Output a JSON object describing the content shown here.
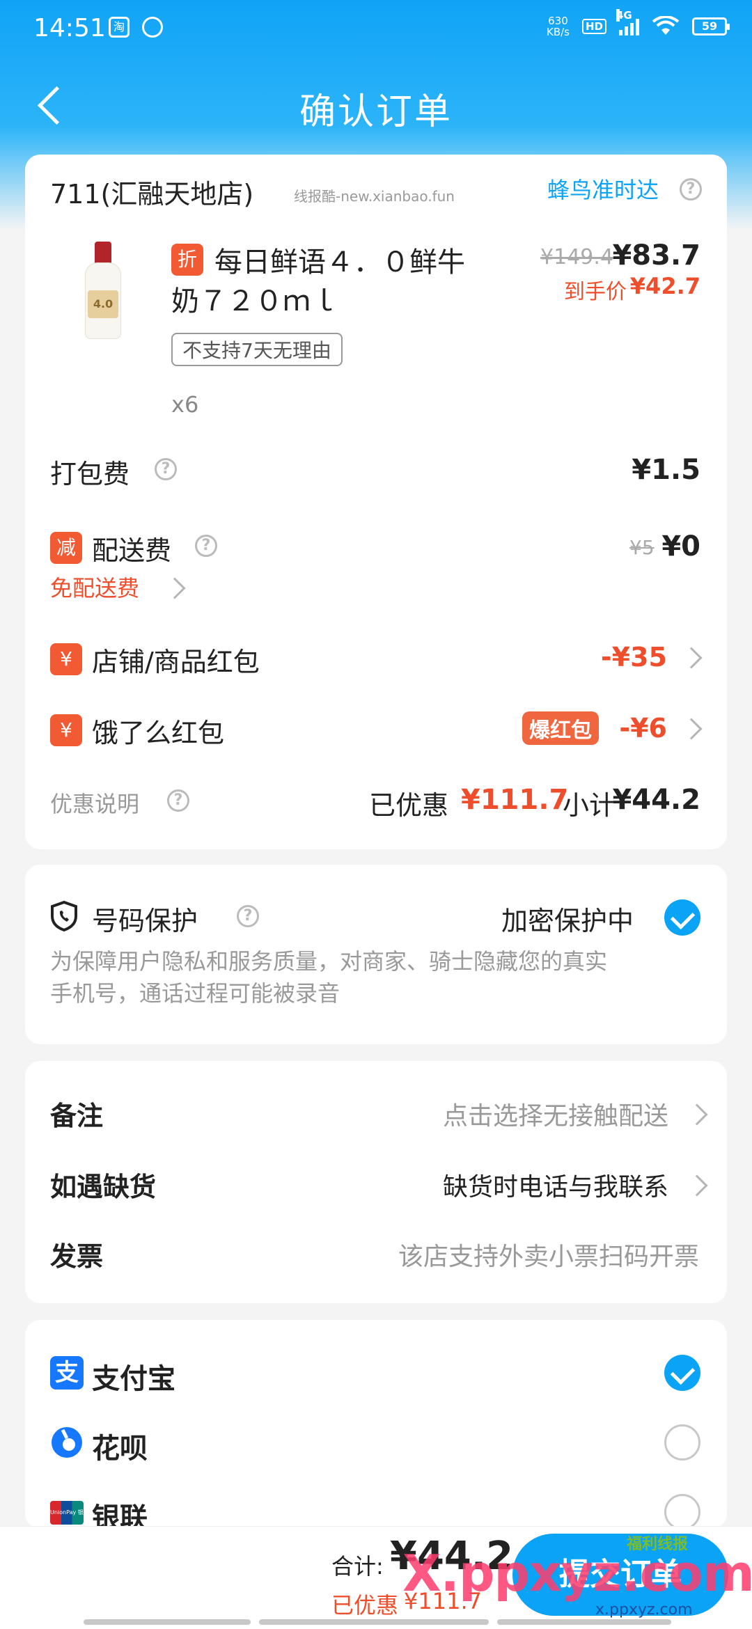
{
  "status_bar": {
    "time": "14:51",
    "app_icon_1": "淘",
    "net_speed_value": "630",
    "net_speed_unit": "KB/s",
    "hd_label": "HD",
    "network": "4G",
    "battery": "59"
  },
  "nav": {
    "title": "确认订单",
    "back_icon": "chevron-left-icon"
  },
  "store": {
    "name": "711(汇融天地店)",
    "watermark": "线报酷-new.xianbao.fun",
    "delivery_label": "蜂鸟准时达"
  },
  "product": {
    "discount_tag": "折",
    "name_line1": "每日鲜语４．０鲜牛",
    "name_line2": "奶７２０ｍｌ",
    "original_price": "¥149.4",
    "price": "¥83.7",
    "final_price_label": "到手价",
    "final_price": "¥42.7",
    "no_return_tag": "不支持7天无理由",
    "quantity": "x6",
    "bottle_label": "4.0"
  },
  "fees": {
    "packing_label": "打包费",
    "packing_value": "¥1.5",
    "delivery_badge": "减",
    "delivery_label": "配送费",
    "delivery_original": "¥5",
    "delivery_value": "¥0",
    "free_delivery_label": "免配送费",
    "store_coupon_badge": "¥",
    "store_coupon_label": "店铺/商品红包",
    "store_coupon_value": "-¥35",
    "ele_coupon_badge": "¥",
    "ele_coupon_label": "饿了么红包",
    "ele_coupon_tag": "爆红包",
    "ele_coupon_value": "-¥6",
    "discount_info_label": "优惠说明",
    "saved_label": "已优惠",
    "saved_value": "¥111.7",
    "subtotal_label": "小计",
    "subtotal_value": "¥44.2"
  },
  "privacy": {
    "title": "号码保护",
    "status": "加密保护中",
    "desc_line1": "为保障用户隐私和服务质量，对商家、骑士隐藏您的真实",
    "desc_line2": "手机号，通话过程可能被录音"
  },
  "options": {
    "remark_label": "备注",
    "remark_value": "点击选择无接触配送",
    "stockout_label": "如遇缺货",
    "stockout_value": "缺货时电话与我联系",
    "invoice_label": "发票",
    "invoice_value": "该店支持外卖小票扫码开票"
  },
  "payment": {
    "alipay_label": "支付宝",
    "alipay_icon": "支",
    "huabei_label": "花呗",
    "unionpay_label": "银联",
    "unionpay_icon": "UnionPay 银联",
    "alipay_selected": true
  },
  "bottom": {
    "total_label": "合计:",
    "total_value": "¥44.2",
    "saved_label": "已优惠",
    "saved_value": "¥111.7",
    "submit_label": "提交订单",
    "watermark": "X.ppxyz.com",
    "watermark_sub": "x.ppxyz.com",
    "watermark_tag": "福利线报"
  },
  "colors": {
    "accent": "#0aa3f5",
    "header": "#10a3f7",
    "red": "#ee4e2b"
  }
}
